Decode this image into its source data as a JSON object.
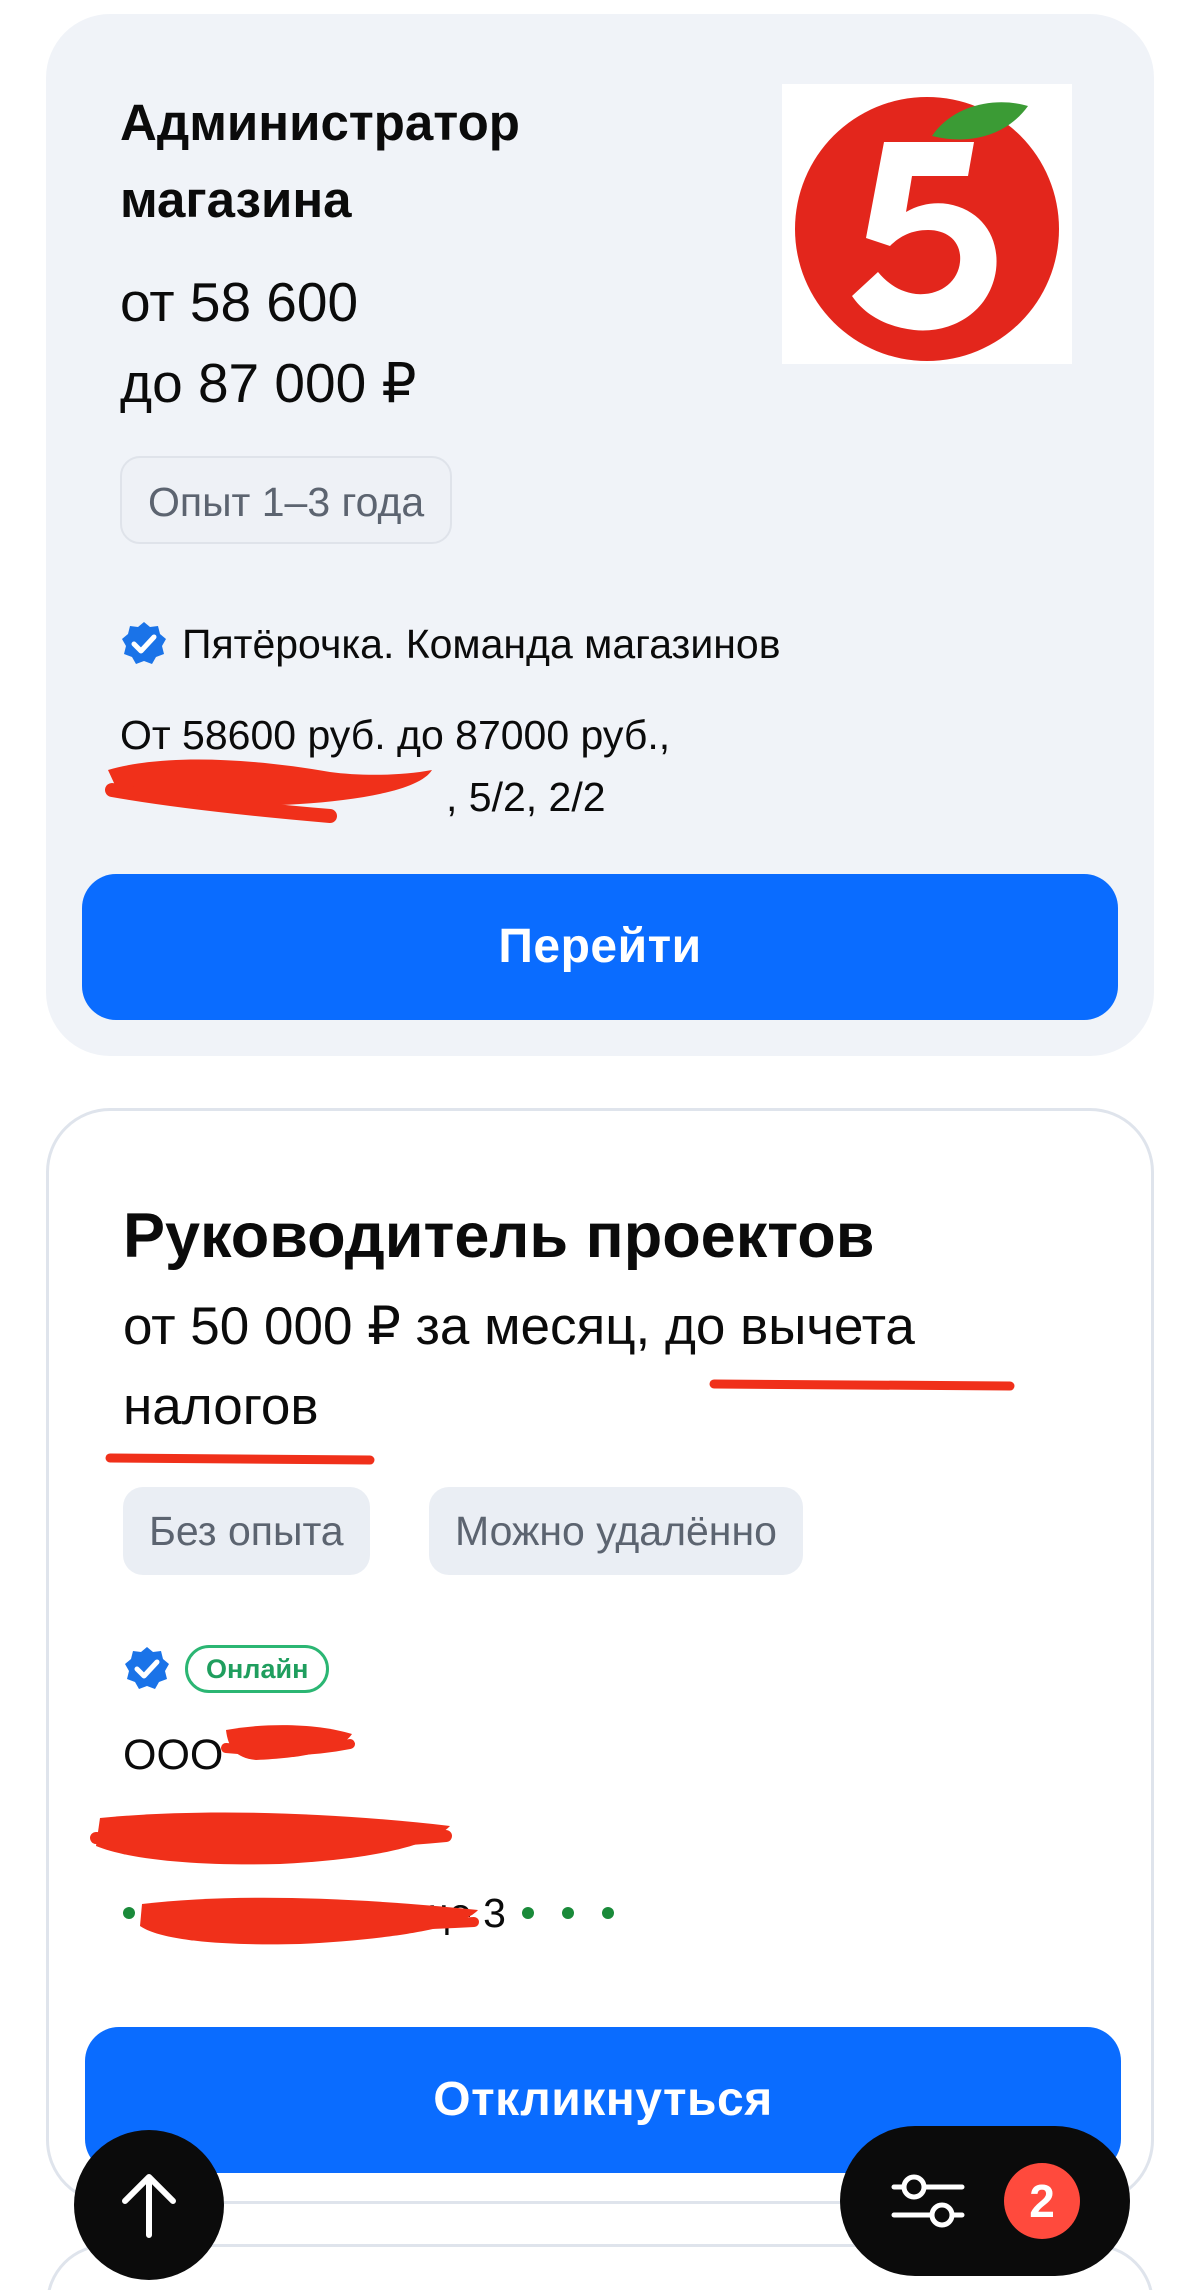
{
  "vacancies": [
    {
      "title": "Администратор магазина",
      "salary_line1": "от 58 600",
      "salary_line2": "до 87 000 ₽",
      "tags": [
        "Опыт 1–3 года"
      ],
      "company": "Пятёрочка. Команда магазинов",
      "description_line1": "От 58600 руб. до 87000 руб.,",
      "description_line2_visible": ", 5/2, 2/2",
      "button_label": "Перейти",
      "logo_icon": "pyaterochka-logo-icon",
      "logo_colors": {
        "red": "#e3261c",
        "green": "#3b9b35",
        "white": "#ffffff"
      }
    },
    {
      "title": "Руководитель проектов",
      "salary": "от 50 000 ₽ за месяц, до вычета налогов",
      "tags": [
        "Без опыта",
        "Можно удалённо"
      ],
      "badge": "Онлайн",
      "company_visible": "ООО",
      "metro_visible": "я и еще 3",
      "button_label": "Откликнуться"
    }
  ],
  "fab": {
    "scroll_up_icon": "arrow-up-icon",
    "filter_icon": "sliders-icon",
    "filter_count": "2"
  },
  "colors": {
    "primary": "#0a6cff",
    "card_bg": "#f0f3f8",
    "verified": "#1a73e8",
    "online": "#2bb673",
    "badge": "#ff4a3d",
    "redaction": "#f0301a"
  }
}
